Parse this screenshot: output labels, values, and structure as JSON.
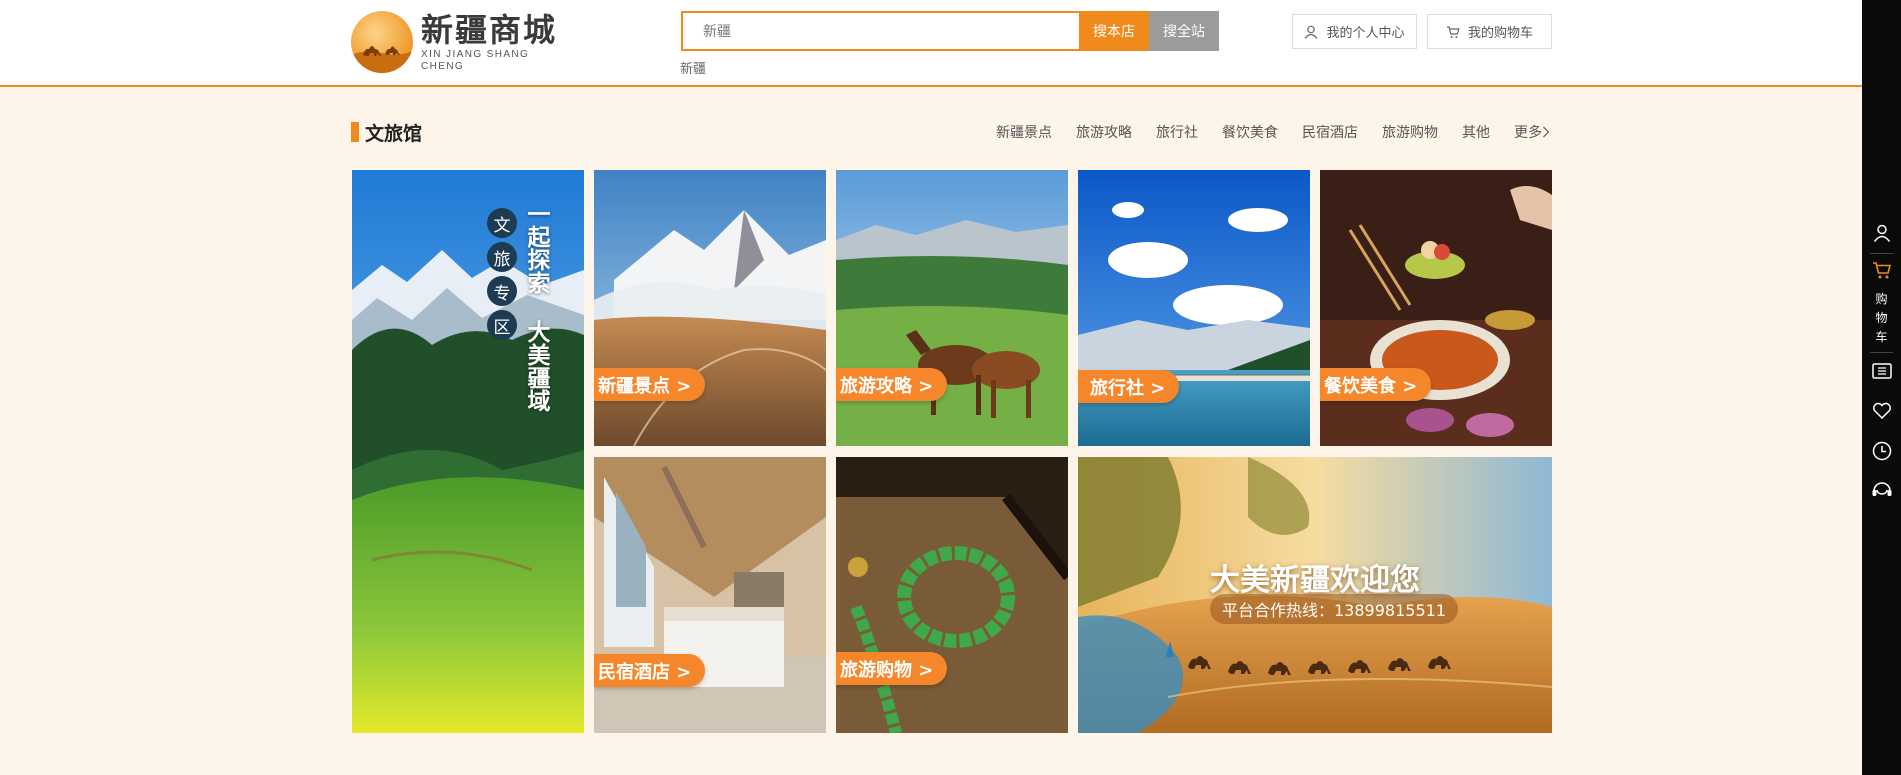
{
  "header": {
    "logo_cn": "新疆商城",
    "logo_en": "XIN JIANG SHANG CHENG",
    "search_value": "新疆",
    "search_store_label": "搜本店",
    "search_site_label": "搜全站",
    "hot_keyword": "新疆",
    "user_center_label": "我的个人中心",
    "cart_label": "我的购物车",
    "accent_color": "#f08a1c"
  },
  "right_sidebar": {
    "items": [
      "user-icon",
      "cart-icon",
      "ticket-icon",
      "heart-icon",
      "clock-icon",
      "headset-icon"
    ],
    "cart_text": [
      "购",
      "物",
      "车"
    ]
  },
  "section": {
    "title": "文旅馆",
    "nav": [
      "新疆景点",
      "旅游攻略",
      "旅行社",
      "餐饮美食",
      "民宿酒店",
      "旅游购物",
      "其他"
    ],
    "more_label": "更多"
  },
  "tiles": {
    "hero": {
      "circle_chars": [
        "文",
        "旅",
        "专",
        "区"
      ],
      "line1": "一起探索",
      "line2": "大美疆域"
    },
    "scenic": "新疆景点 >",
    "guide": "旅游攻略 >",
    "agency": "旅行社 >",
    "food": "餐饮美食 >",
    "hotel": "民宿酒店 >",
    "shopping": "旅游购物 >",
    "banner": {
      "title": "大美新疆欢迎您",
      "hotline": "平台合作热线：13899815511"
    }
  }
}
